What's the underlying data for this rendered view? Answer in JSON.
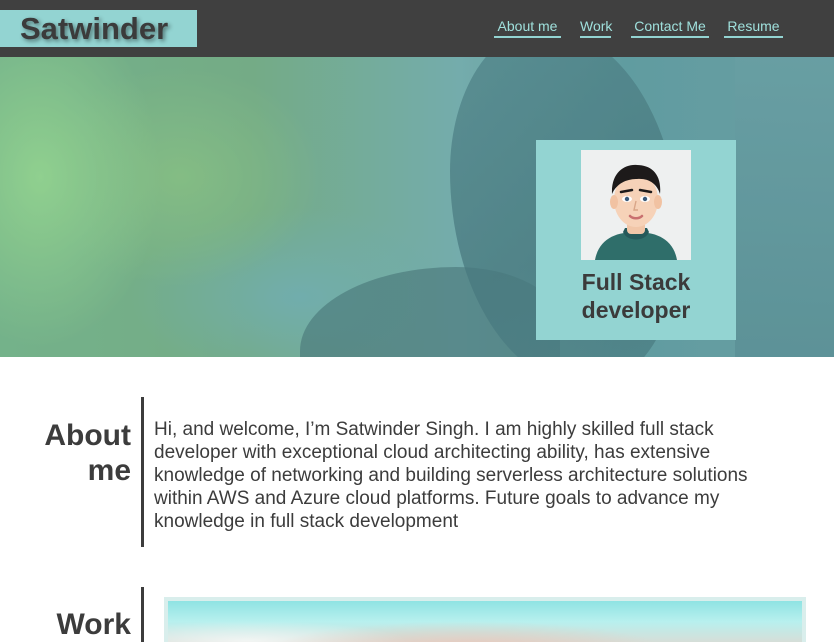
{
  "header": {
    "logo": "Satwinder",
    "nav": [
      {
        "label": "About me"
      },
      {
        "label": "Work"
      },
      {
        "label": "Contact Me"
      },
      {
        "label": "Resume"
      }
    ]
  },
  "hero": {
    "card_title": "Full Stack developer"
  },
  "about": {
    "title": "About me",
    "text": "Hi, and welcome, I’m Satwinder Singh. I am highly skilled full stack developer with exceptional cloud architecting ability, has extensive knowledge of networking and building serverless architecture solutions within AWS and Azure cloud platforms. Future goals to advance my knowledge in full stack development"
  },
  "work": {
    "title": "Work"
  },
  "colors": {
    "header_bg": "#404040",
    "accent": "#93d4d2",
    "nav_text": "#9fe0dc",
    "text": "#3c3c3c"
  }
}
